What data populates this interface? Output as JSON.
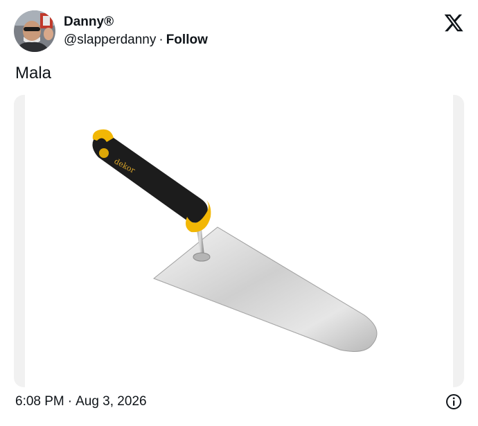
{
  "author": {
    "display_name": "Danny®",
    "handle": "@slapperdanny",
    "separator": "·",
    "follow_label": "Follow",
    "avatar_icon": "avatar-photo"
  },
  "header": {
    "brand_icon": "x-logo-icon"
  },
  "tweet": {
    "text": "Mala"
  },
  "media": {
    "brand_text": "dekor",
    "handle_color": "#1c1c1c",
    "grip_color": "#f2b705",
    "blade_color": "#c9c9c9"
  },
  "footer": {
    "time": "6:08 PM",
    "separator": "·",
    "date": "Aug 3, 2026",
    "info_icon": "info-icon"
  },
  "colors": {
    "text": "#0f1419",
    "background": "#ffffff",
    "media_border": "#f1f1f1"
  }
}
